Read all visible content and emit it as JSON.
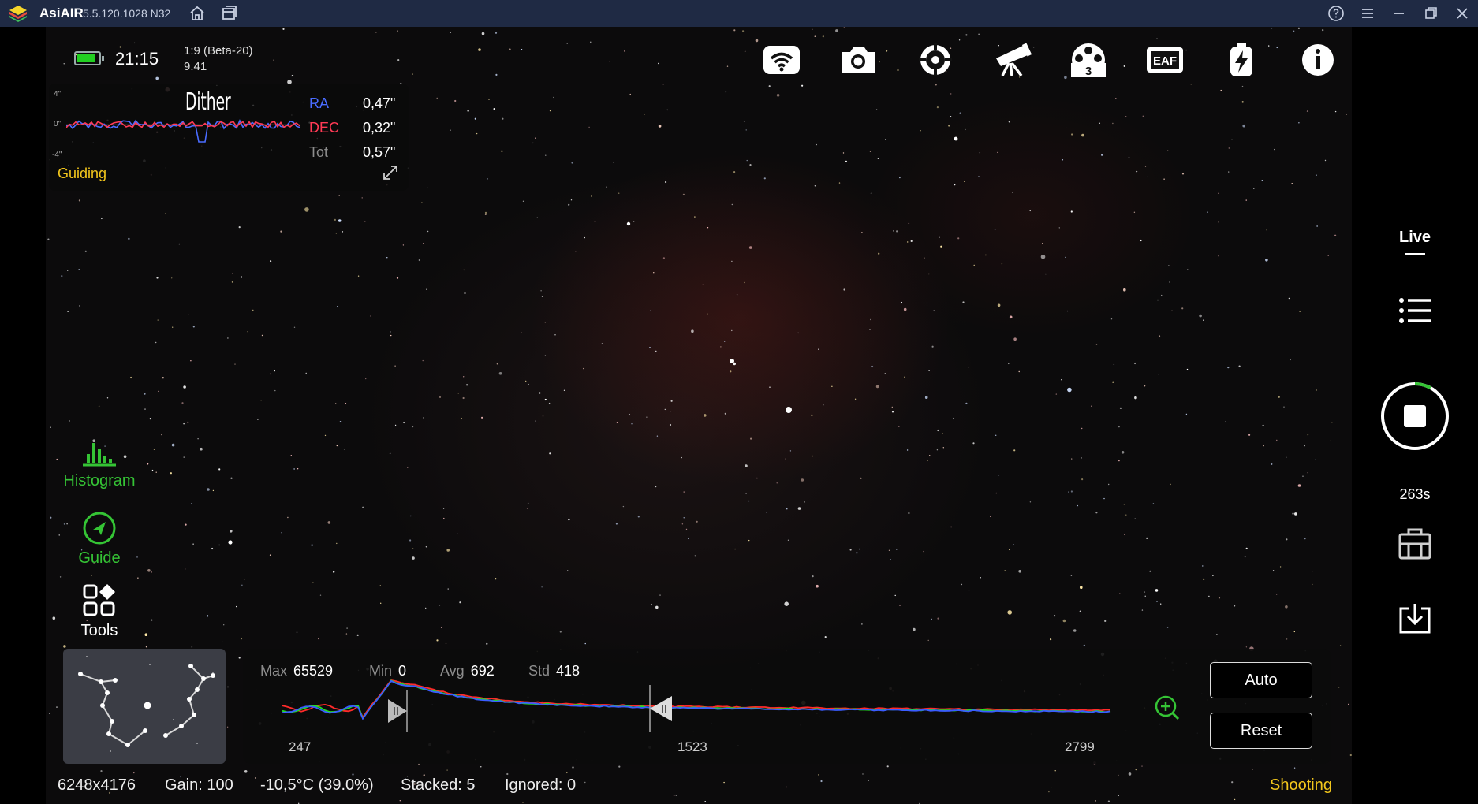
{
  "window": {
    "app_name": "AsiAIR",
    "version": "5.5.120.1028 N32"
  },
  "status": {
    "time": "21:15",
    "session_line1": "1:9 (Beta-20)",
    "session_line2": "9.41",
    "battery_level": 0.9,
    "battery_color": "#22d022"
  },
  "guiding": {
    "event_label": "Dither",
    "state": "Guiding",
    "axis_top": "4\"",
    "axis_mid": "0\"",
    "axis_bottom": "-4\"",
    "ra_label": "RA",
    "ra_value": "0,47\"",
    "dec_label": "DEC",
    "dec_value": "0,32\"",
    "tot_label": "Tot",
    "tot_value": "0,57\"",
    "ra_color": "#4a6cff",
    "dec_color": "#ff3a55"
  },
  "toolbar": {
    "icons": [
      "wifi-icon",
      "camera-icon",
      "focuser-target-icon",
      "telescope-icon",
      "filter-wheel-icon",
      "eaf-icon",
      "power-icon",
      "info-icon"
    ],
    "filter_wheel_slot": "3",
    "eaf_text": "EAF"
  },
  "left_tools": {
    "histogram": "Histogram",
    "guide": "Guide",
    "tools": "Tools",
    "accent": "#35c435"
  },
  "histogram": {
    "max_label": "Max",
    "max_value": "65529",
    "min_label": "Min",
    "min_value": "0",
    "avg_label": "Avg",
    "avg_value": "692",
    "std_label": "Std",
    "std_value": "418",
    "axis_left": "247",
    "axis_mid": "1523",
    "axis_right": "2799",
    "auto_label": "Auto",
    "reset_label": "Reset"
  },
  "bottom_status": {
    "resolution": "6248x4176",
    "gain": "Gain: 100",
    "temperature": "-10,5°C  (39.0%)",
    "stacked": "Stacked: 5",
    "ignored": "Ignored: 0",
    "state": "Shooting"
  },
  "right_rail": {
    "mode": "Live",
    "countdown": "263s",
    "exposure_progress": 0.08
  }
}
